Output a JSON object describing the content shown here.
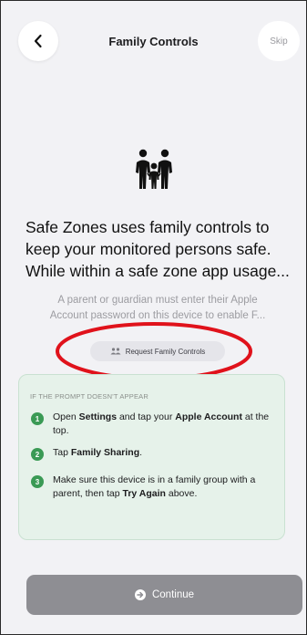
{
  "header": {
    "title": "Family Controls",
    "skip_label": "Skip",
    "back_icon": "chevron-left-icon"
  },
  "hero": {
    "icon": "family-icon",
    "headline_lines": [
      "Safe Zones uses family controls to",
      "keep your monitored persons safe.",
      "While within a safe zone app usage..."
    ],
    "subtitle_lines": [
      "A parent or guardian must enter their Apple",
      "Account password on this device to enable F..."
    ]
  },
  "request_button": {
    "label": "Request Family Controls",
    "icon": "people-icon",
    "highlighted": true,
    "highlight_color": "#e0121b"
  },
  "help": {
    "heading": "IF THE PROMPT DOESN'T APPEAR",
    "steps": [
      {
        "num": "1",
        "t1": "Open ",
        "b1": "Settings",
        "t2": " and tap your ",
        "b2": "Apple Account",
        "t3": " at the top."
      },
      {
        "num": "2",
        "t1": "Tap ",
        "b1": "Family Sharing",
        "t2": "."
      },
      {
        "num": "3",
        "t1": "Make sure this device is in a family group with a parent, then tap ",
        "b1": "Try Again",
        "t2": " above."
      }
    ]
  },
  "footer": {
    "continue_label": "Continue",
    "continue_icon": "arrow-circle-right-icon"
  },
  "colors": {
    "background": "#f2f2f5",
    "help_bg": "#e6f2ea",
    "step_green": "#3a9a55",
    "continue_disabled": "#8e8e93"
  }
}
